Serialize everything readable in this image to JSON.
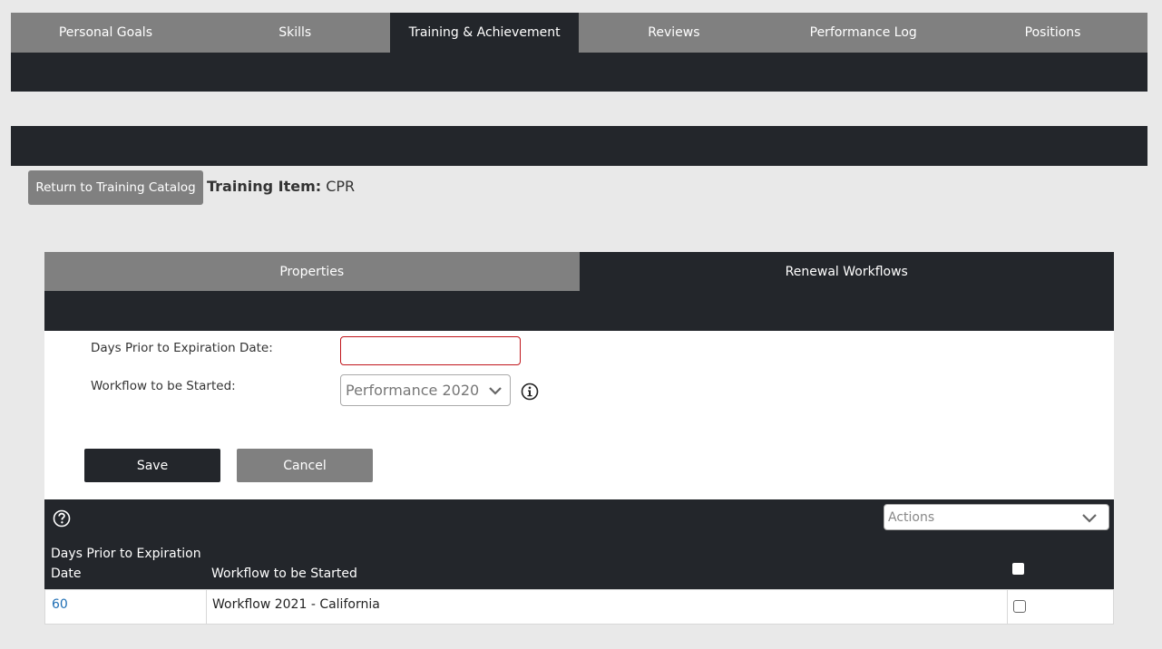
{
  "top_nav": {
    "tabs": [
      {
        "label": "Personal Goals"
      },
      {
        "label": "Skills"
      },
      {
        "label": "Training & Achievement"
      },
      {
        "label": "Reviews"
      },
      {
        "label": "Performance Log"
      },
      {
        "label": "Positions"
      }
    ],
    "active_index": 2
  },
  "header": {
    "return_button": "Return to Training Catalog",
    "training_item_label": "Training Item:",
    "training_item_value": "CPR"
  },
  "sub_tabs": {
    "tabs": [
      {
        "label": "Properties"
      },
      {
        "label": "Renewal Workflows"
      }
    ],
    "active_index": 1
  },
  "form": {
    "days_label": "Days Prior to Expiration Date:",
    "days_value": "",
    "workflow_label": "Workflow to be Started:",
    "workflow_selected": "Performance 2020",
    "save_label": "Save",
    "cancel_label": "Cancel"
  },
  "grid": {
    "actions_placeholder": "Actions",
    "columns": {
      "days_line1": "Days Prior to Expiration",
      "days_line2": "Date",
      "workflow": "Workflow to be Started"
    },
    "rows": [
      {
        "days": "60",
        "workflow": "Workflow 2021 - California"
      }
    ]
  },
  "colors": {
    "dark": "#23262b",
    "gray": "#808080",
    "background": "#e9e9e9",
    "link": "#1f6fb5",
    "input_error_border": "#c0151b"
  }
}
